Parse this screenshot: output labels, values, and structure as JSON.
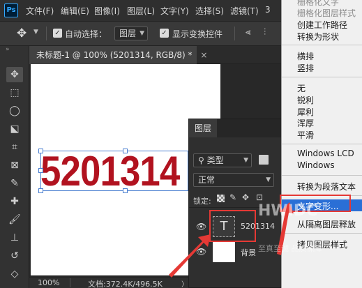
{
  "menubar": {
    "logo": "Ps",
    "items": [
      "文件(F)",
      "编辑(E)",
      "图像(I)",
      "图层(L)",
      "文字(Y)",
      "选择(S)",
      "滤镜(T)",
      "3"
    ]
  },
  "options": {
    "auto_select_label": "自动选择：",
    "auto_select_value": "图层",
    "show_transform_label": "显示变换控件"
  },
  "document": {
    "tab_title": "未标题-1 @ 100% (5201314, RGB/8) *",
    "canvas_text": "5201314",
    "text_color": "#b1121f"
  },
  "status": {
    "zoom": "100%",
    "doc_info": "文档:372.4K/496.5K"
  },
  "layers_panel": {
    "title": "图层",
    "filter_type": "类型",
    "blend_mode": "正常",
    "lock_label": "锁定:",
    "layers": [
      {
        "thumb": "T",
        "name": "5201314"
      },
      {
        "thumb": "",
        "name": "背景"
      }
    ]
  },
  "context_menu": {
    "items": [
      {
        "label": "栅格化文字",
        "disabled": true
      },
      {
        "label": "栅格化图层样式",
        "disabled": true
      },
      {
        "label": "创建工作路径",
        "disabled": false
      },
      {
        "label": "转换为形状",
        "disabled": false
      },
      {
        "label": "横排",
        "disabled": false
      },
      {
        "label": "竖排",
        "disabled": false
      },
      {
        "label": "无",
        "disabled": false
      },
      {
        "label": "锐利",
        "disabled": false
      },
      {
        "label": "犀利",
        "disabled": false
      },
      {
        "label": "浑厚",
        "disabled": false
      },
      {
        "label": "平滑",
        "disabled": false
      },
      {
        "label": "Windows LCD",
        "disabled": false
      },
      {
        "label": "Windows",
        "disabled": false
      },
      {
        "label": "转换为段落文本",
        "disabled": false
      },
      {
        "label": "文字变形...",
        "highlighted": true
      },
      {
        "label": "从隔离图层释放",
        "disabled": false
      },
      {
        "label": "拷贝图层样式",
        "disabled": false
      }
    ],
    "highlight_color": "#2a6fd6"
  },
  "watermark": {
    "brand": "HWIDC",
    "sub": "至真至诚 品质保障"
  }
}
